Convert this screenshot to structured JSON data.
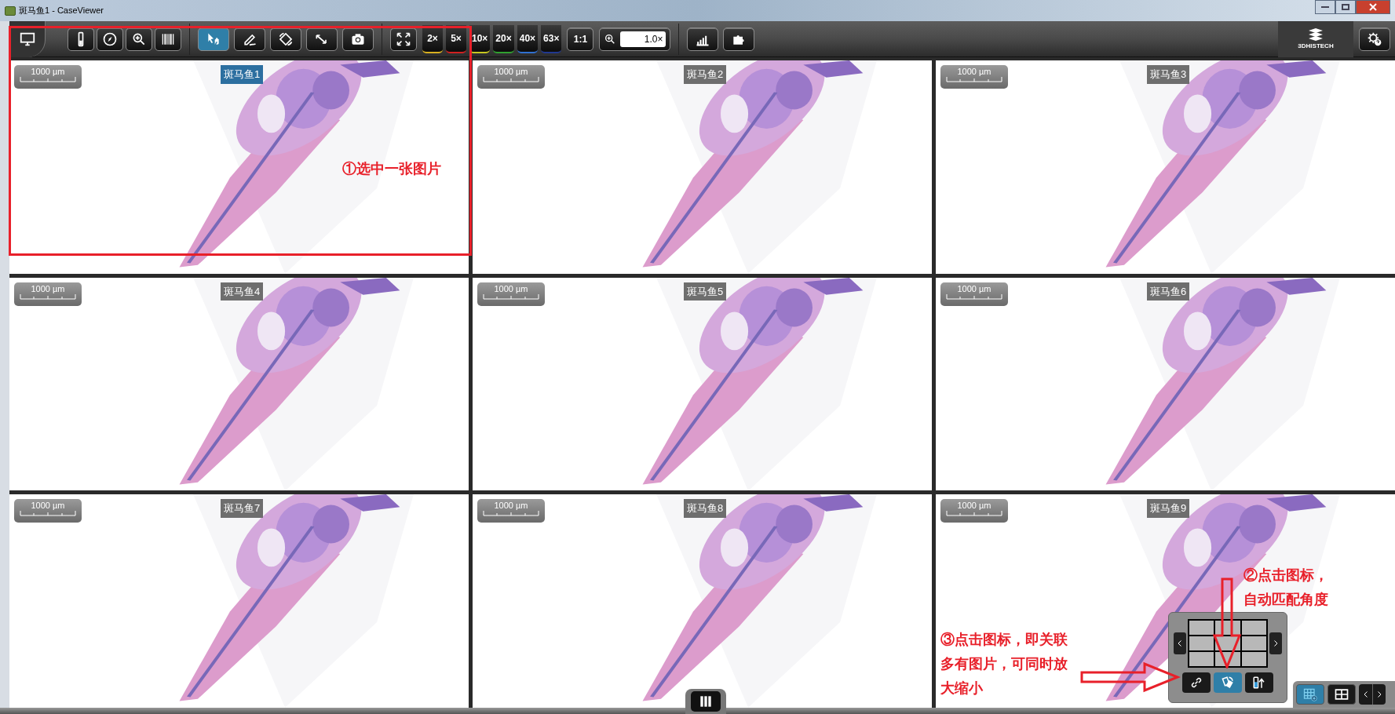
{
  "window": {
    "title": "斑马鱼1 - CaseViewer"
  },
  "toolbar": {
    "mode_tools": [
      {
        "selected": true
      },
      {
        "selected": false
      },
      {
        "selected": false
      },
      {
        "selected": false
      }
    ],
    "zoom_presets": [
      {
        "label": "2×",
        "color": "#d8b020"
      },
      {
        "label": "5×",
        "color": "#d02020"
      },
      {
        "label": "10×",
        "color": "#c8c820"
      },
      {
        "label": "20×",
        "color": "#30a030"
      },
      {
        "label": "40×",
        "color": "#3070d0"
      },
      {
        "label": "63×",
        "color": "#203890"
      }
    ],
    "one_to_one": "1:1",
    "zoom_field": {
      "value": "1.0×"
    },
    "logo": "3DHISTECH"
  },
  "panels": [
    {
      "label": "斑马鱼1",
      "selected": true,
      "scale": "1000 µm"
    },
    {
      "label": "斑马鱼2",
      "selected": false,
      "scale": "1000 µm"
    },
    {
      "label": "斑马鱼3",
      "selected": false,
      "scale": "1000 µm"
    },
    {
      "label": "斑马鱼4",
      "selected": false,
      "scale": "1000 µm"
    },
    {
      "label": "斑马鱼5",
      "selected": false,
      "scale": "1000 µm"
    },
    {
      "label": "斑马鱼6",
      "selected": false,
      "scale": "1000 µm"
    },
    {
      "label": "斑马鱼7",
      "selected": false,
      "scale": "1000 µm"
    },
    {
      "label": "斑马鱼8",
      "selected": false,
      "scale": "1000 µm"
    },
    {
      "label": "斑马鱼9",
      "selected": false,
      "scale": "1000 µm"
    }
  ],
  "navigator": {
    "sync_buttons": [
      {
        "selected": false
      },
      {
        "selected": true
      },
      {
        "selected": false
      }
    ]
  },
  "layout_buttons": [
    {
      "selected": true
    },
    {
      "selected": false
    }
  ],
  "annotations": [
    {
      "kind": "box"
    },
    {
      "kind": "note",
      "lines": [
        "①选中一张图片"
      ]
    },
    {
      "kind": "note",
      "lines": [
        "②点击图标，",
        "自动匹配角度"
      ]
    },
    {
      "kind": "arrow_down"
    },
    {
      "kind": "note",
      "lines": [
        "③点击图标，即关联",
        "多有图片，可同时放",
        "大缩小"
      ]
    },
    {
      "kind": "arrow_right"
    }
  ]
}
